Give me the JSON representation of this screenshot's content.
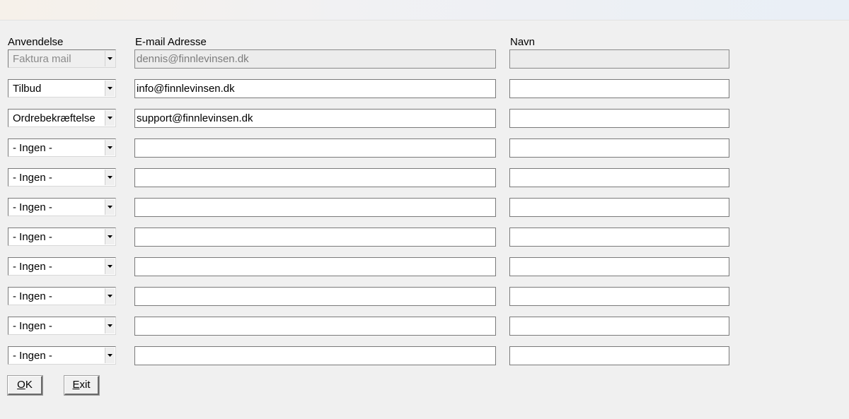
{
  "headers": {
    "usage": "Anvendelse",
    "email": "E-mail Adresse",
    "name": "Navn"
  },
  "rows": [
    {
      "usage": "Faktura mail",
      "email": "dennis@finnlevinsen.dk",
      "name": "",
      "disabled": true
    },
    {
      "usage": "Tilbud",
      "email": "info@finnlevinsen.dk",
      "name": ""
    },
    {
      "usage": "Ordrebekræftelse",
      "email": "support@finnlevinsen.dk",
      "name": ""
    },
    {
      "usage": "- Ingen -",
      "email": "",
      "name": ""
    },
    {
      "usage": "- Ingen -",
      "email": "",
      "name": ""
    },
    {
      "usage": "- Ingen -",
      "email": "",
      "name": ""
    },
    {
      "usage": "- Ingen -",
      "email": "",
      "name": ""
    },
    {
      "usage": "- Ingen -",
      "email": "",
      "name": ""
    },
    {
      "usage": "- Ingen -",
      "email": "",
      "name": ""
    },
    {
      "usage": "- Ingen -",
      "email": "",
      "name": ""
    },
    {
      "usage": "- Ingen -",
      "email": "",
      "name": ""
    }
  ],
  "buttons": {
    "ok_mnemonic": "O",
    "ok_rest": "K",
    "exit_mnemonic": "E",
    "exit_rest": "xit"
  }
}
